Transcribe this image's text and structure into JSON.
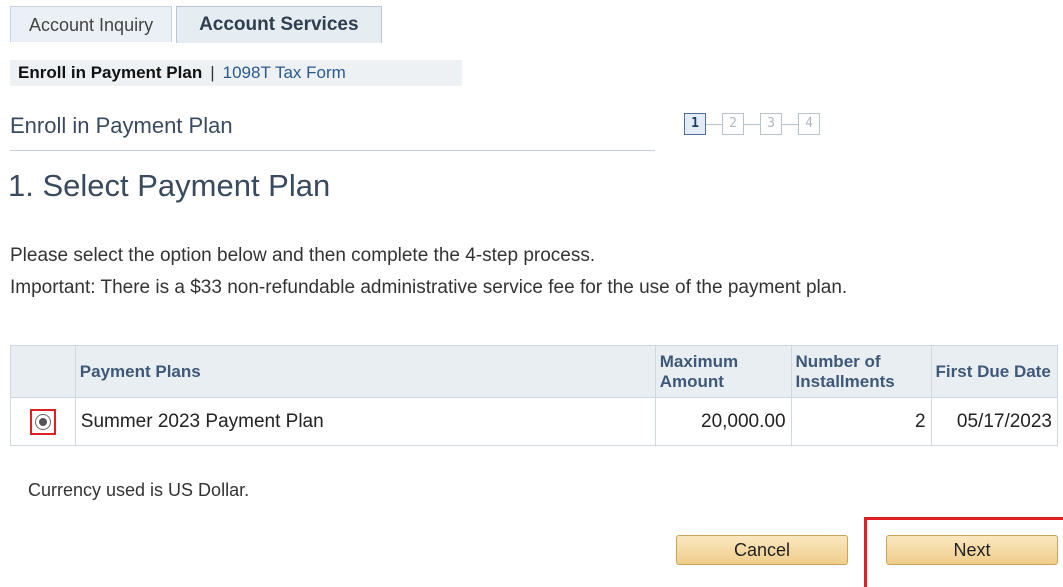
{
  "tabs": [
    {
      "label": "Account Inquiry",
      "active": false
    },
    {
      "label": "Account Services",
      "active": true
    }
  ],
  "subnav": {
    "current": "Enroll in Payment Plan",
    "separator": "|",
    "link": "1098T Tax Form"
  },
  "page_title": "Enroll in Payment Plan",
  "steps": [
    "1",
    "2",
    "3",
    "4"
  ],
  "current_step": 1,
  "heading": "1. Select Payment Plan",
  "instructions": {
    "line1": "Please select the option below and then complete the 4-step process.",
    "line2": "Important: There is a $33 non-refundable administrative service fee for the use of the payment plan."
  },
  "table": {
    "headers": {
      "plan": "Payment Plans",
      "max_amount": "Maximum Amount",
      "installments": "Number of Installments",
      "first_due": "First Due Date"
    },
    "rows": [
      {
        "plan": "Summer 2023 Payment Plan",
        "max_amount": "20,000.00",
        "installments": "2",
        "first_due": "05/17/2023",
        "selected": true
      }
    ]
  },
  "currency_note": "Currency used is US Dollar.",
  "buttons": {
    "cancel": "Cancel",
    "next": "Next"
  },
  "colors": {
    "accent_highlight": "#e02020",
    "button_fill": "#f0cd8b",
    "header_text": "#3f5877"
  }
}
